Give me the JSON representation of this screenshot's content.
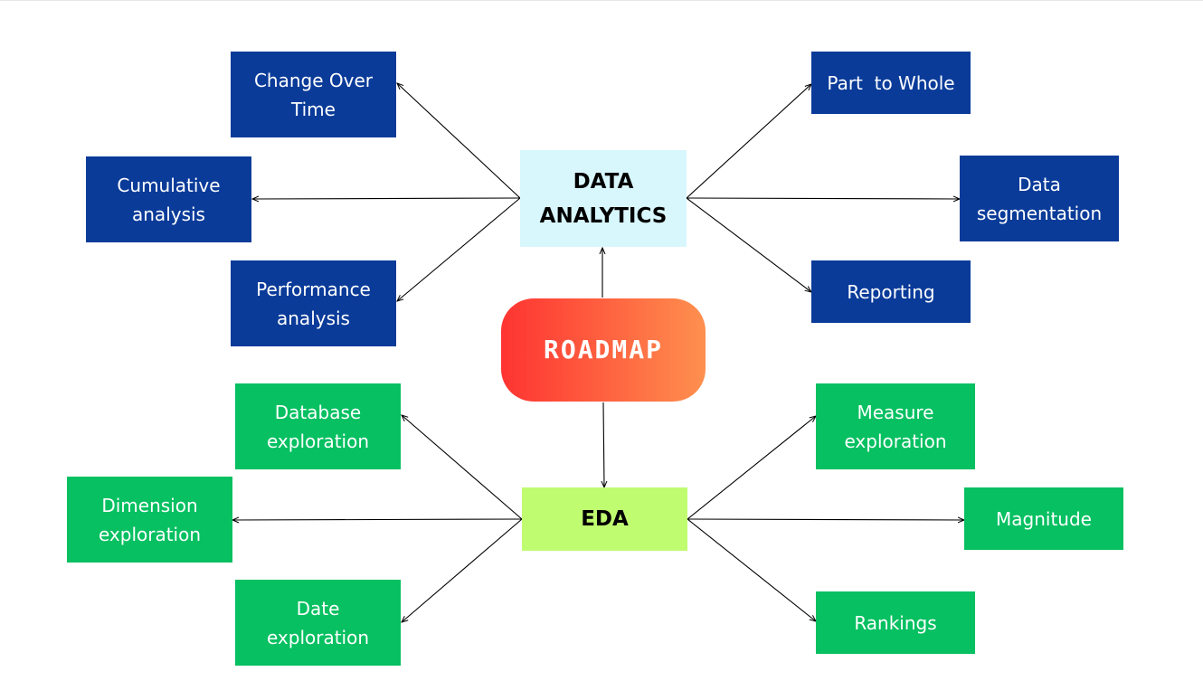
{
  "center": {
    "label": "ROADMAP"
  },
  "data_analytics": {
    "label": "DATA\nANALYTICS",
    "branches": [
      "Change Over\nTime",
      "Cumulative\nanalysis",
      "Performance\nanalysis",
      "Part  to Whole",
      "Data\nsegmentation",
      "Reporting"
    ]
  },
  "eda": {
    "label": "EDA",
    "branches": [
      "Database\nexploration",
      "Dimension\nexploration",
      "Date\nexploration",
      "Measure\nexploration",
      "Magnitude",
      "Rankings"
    ]
  },
  "colors": {
    "analytics_branch": "#0a3b99",
    "eda_branch": "#06c061",
    "analytics_hub": "#d8f7fd",
    "eda_hub": "#bffc70",
    "roadmap_gradient": [
      "#fe3432",
      "#fe904f"
    ],
    "connector": "#000000"
  }
}
